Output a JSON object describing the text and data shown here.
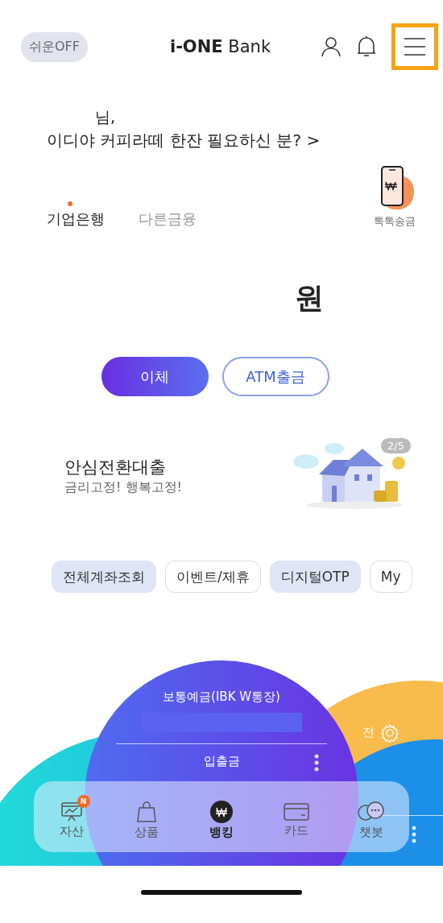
{
  "header": {
    "easy_mode": "쉬운OFF",
    "logo": "**i-ONE** Bank",
    "menu_highlighted": true
  },
  "greeting": {
    "name_suffix": "님,",
    "headline": "이디야 커피라떼 한잔 필요하신 분? >"
  },
  "tabs": [
    {
      "label": "기업은행",
      "selected": true
    },
    {
      "label": "다른금융",
      "selected": false
    }
  ],
  "quick_send": {
    "label": "톡톡송금"
  },
  "balance": {
    "unit": "원"
  },
  "actions": [
    {
      "label": "이체",
      "kind": "primary"
    },
    {
      "label": "ATM출금",
      "kind": "outline"
    }
  ],
  "banner": {
    "title": "안심전환대출",
    "subtitle": "금리고정! 행복고정!",
    "page": "2/5"
  },
  "chips": [
    {
      "label": "전체계좌조회",
      "kind": "filled"
    },
    {
      "label": "이벤트/제휴",
      "kind": "outline"
    },
    {
      "label": "디지털OTP",
      "kind": "filled"
    },
    {
      "label": "My",
      "kind": "outline"
    }
  ],
  "account_card": {
    "title": "보통예금(IBK W통장)",
    "type": "입출금"
  },
  "back_cards": [
    {
      "text": "전",
      "kind": "orange"
    }
  ],
  "nav": [
    {
      "label": "자산",
      "kind": "asset",
      "badge": "N",
      "selected": false
    },
    {
      "label": "상품",
      "kind": "bag",
      "selected": false
    },
    {
      "label": "뱅킹",
      "kind": "won",
      "selected": true
    },
    {
      "label": "카드",
      "kind": "card",
      "selected": false
    },
    {
      "label": "챗봇",
      "kind": "chat",
      "selected": false
    }
  ]
}
